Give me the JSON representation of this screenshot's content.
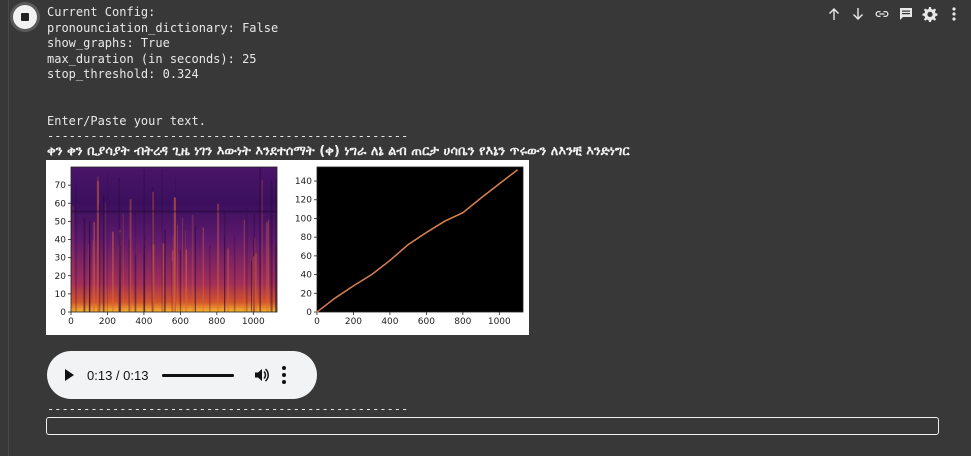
{
  "cell": {
    "toolbar_icons": [
      "arrow-up-icon",
      "arrow-down-icon",
      "link-icon",
      "comment-icon",
      "gear-icon",
      "more-vert-icon"
    ]
  },
  "output": {
    "config_lines": [
      "Current Config:",
      "pronounciation_dictionary: False",
      "show_graphs: True",
      "max_duration (in seconds): 25",
      "stop_threshold: 0.324"
    ],
    "prompt": "Enter/Paste your text.",
    "separator": "--------------------------------------------------",
    "amharic_text": "ቀን ቀን ቢያሳያት ብትረዳ ጊዜ ነገን እውነት እንደተሰማት (ቀ) ነግራ ለኔ ልብ ጠርታ ሀሳቤን የእኔን ጥሩውን ለእንቺ እንድነግር",
    "separator2": "--------------------------------------------------"
  },
  "chart_data": [
    {
      "type": "heatmap",
      "title": "",
      "xlabel": "",
      "ylabel": "",
      "xlim": [
        0,
        1130
      ],
      "ylim": [
        0,
        80
      ],
      "x_ticks": [
        0,
        200,
        400,
        600,
        800,
        1000
      ],
      "y_ticks": [
        0,
        10,
        20,
        30,
        40,
        50,
        60,
        70
      ],
      "colormap": "inferno"
    },
    {
      "type": "line",
      "title": "",
      "xlabel": "",
      "ylabel": "",
      "xlim": [
        0,
        1130
      ],
      "ylim": [
        0,
        155
      ],
      "x_ticks": [
        0,
        200,
        400,
        600,
        800,
        1000
      ],
      "y_ticks": [
        0,
        20,
        40,
        60,
        80,
        100,
        120,
        140
      ],
      "x": [
        0,
        100,
        200,
        300,
        400,
        500,
        600,
        700,
        800,
        900,
        1000,
        1100
      ],
      "y": [
        0,
        15,
        28,
        40,
        55,
        72,
        85,
        97,
        106,
        122,
        137,
        152
      ],
      "background": "#000000",
      "line_colors": [
        "#f7d13d",
        "#e25563",
        "#8e2c8e"
      ]
    }
  ],
  "audio": {
    "time": "0:13 / 0:13",
    "progress": 1.0,
    "icons": [
      "play-icon",
      "volume-icon",
      "more-vert-icon"
    ]
  },
  "input": {
    "value": ""
  }
}
